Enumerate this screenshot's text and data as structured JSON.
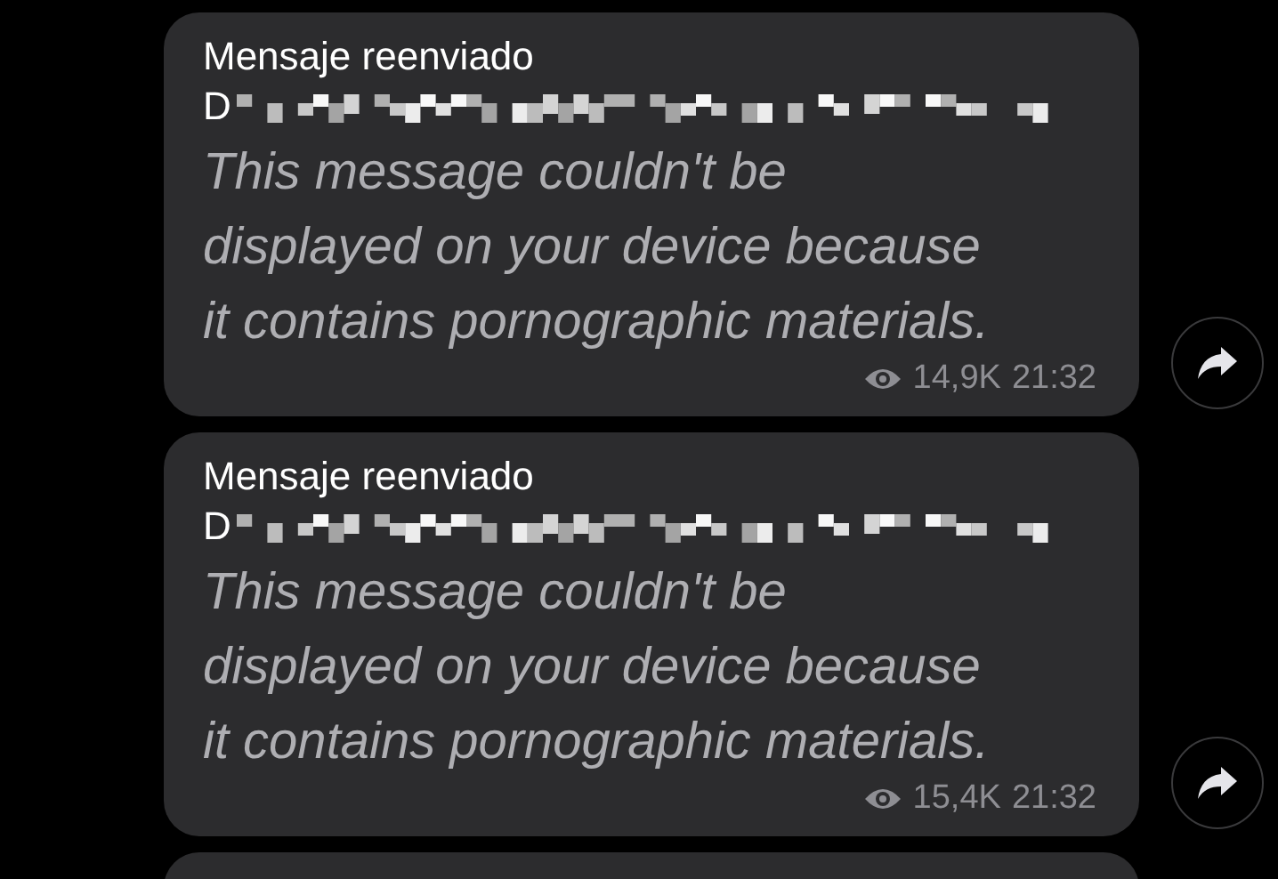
{
  "messages": [
    {
      "header": "Mensaje reenviado",
      "sender_prefix": "D",
      "body": "This message couldn't be\ndisplayed on your device because\nit contains pornographic materials.",
      "views": "14,9K",
      "time": "21:32"
    },
    {
      "header": "Mensaje reenviado",
      "sender_prefix": "D",
      "body": "This message couldn't be\ndisplayed on your device because\nit contains pornographic materials.",
      "views": "15,4K",
      "time": "21:32"
    }
  ]
}
